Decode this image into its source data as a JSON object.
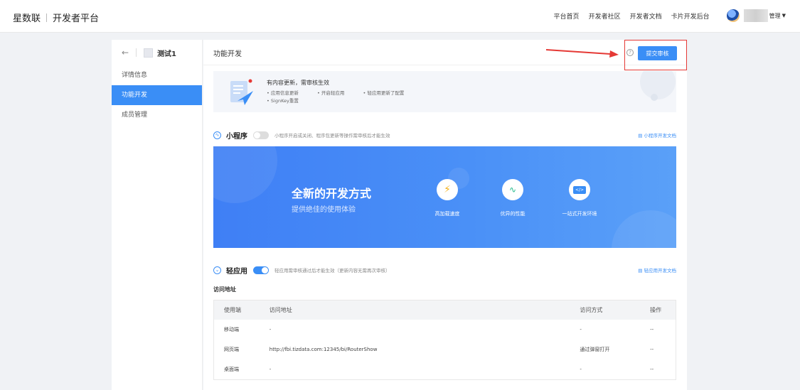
{
  "header": {
    "brand": "星数联",
    "platform": "开发者平台",
    "nav": [
      "平台首页",
      "开发者社区",
      "开发者文档",
      "卡片开发后台"
    ],
    "user_name_suffix": "管理"
  },
  "sidebar": {
    "app_name": "测试1",
    "items": [
      {
        "label": "详情信息",
        "active": false
      },
      {
        "label": "功能开发",
        "active": true
      },
      {
        "label": "成员管理",
        "active": false
      }
    ]
  },
  "main": {
    "title": "功能开发",
    "submit_label": "提交审核",
    "notice": {
      "title": "有内容更新，需审核生效",
      "items": [
        "应用信息更新",
        "开启轻应用",
        "轻应用更新了配置",
        "SignKey重置"
      ]
    },
    "miniprogram": {
      "title": "小程序",
      "enabled": false,
      "desc": "小程序开启或关闭、程序包更新等操作需审核后才能生效",
      "doc_link": "小程序开发文档"
    },
    "banner": {
      "title": "全新的开发方式",
      "subtitle": "提供绝佳的使用体验",
      "features": [
        {
          "label": "高加载速度",
          "icon": "lightning-icon"
        },
        {
          "label": "优异的性能",
          "icon": "pulse-icon"
        },
        {
          "label": "一站式开发环境",
          "icon": "code-icon"
        }
      ]
    },
    "lightapp": {
      "title": "轻应用",
      "enabled": true,
      "desc": "轻应用需审核通过后才能生效（更新内容无需再次审核）",
      "doc_link": "轻应用开发文档"
    },
    "access_heading": "访问地址",
    "table": {
      "headers": [
        "使用端",
        "访问地址",
        "访问方式",
        "操作"
      ],
      "rows": [
        [
          "移动端",
          "-",
          "-",
          "--"
        ],
        [
          "网页端",
          "http://fbi.tizdata.com:12345/bi/RouterShow",
          "通过弹窗打开",
          "--"
        ],
        [
          "桌面端",
          "-",
          "-",
          "--"
        ]
      ]
    }
  },
  "colors": {
    "accent": "#3a8ef6",
    "annotation": "#e53935"
  }
}
